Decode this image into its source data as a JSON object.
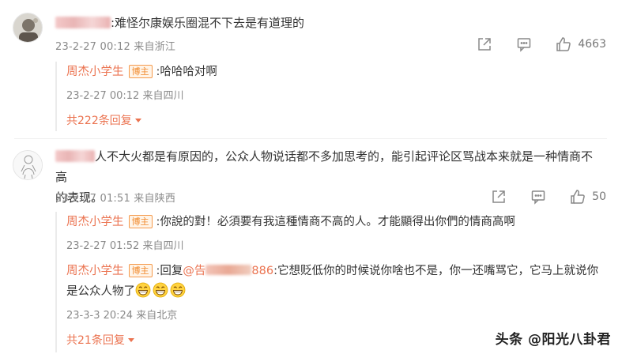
{
  "comments": [
    {
      "text": ":难怪尔康娱乐圈混不下去是有道理的",
      "time": "23-2-27 00:12",
      "location": "来自浙江",
      "like_count": "4663",
      "replies": [
        {
          "username": "周杰小学生",
          "badge": "博主",
          "text": ":哈哈哈对啊",
          "time": "23-2-27 00:12",
          "location": "来自四川"
        }
      ],
      "more_label": "共222条回复"
    },
    {
      "text_line1": "人不大火都是有原因的，公众人物说话都不多加思考的，能引起评论区骂战本来就是一种情商不高",
      "text_line2": "的表现。",
      "time": "23-2-27 01:51",
      "location": "来自陕西",
      "like_count": "50",
      "replies": [
        {
          "username": "周杰小学生",
          "badge": "博主",
          "text": ":你說的對！必須要有我這種情商不高的人。才能顯得出你們的情商高啊",
          "time": "23-2-27 01:52",
          "location": "来自四川"
        },
        {
          "username": "周杰小学生",
          "badge": "博主",
          "text_prefix": ":回复",
          "mention_start": "@告",
          "mention_end": "886",
          "text_line1": ":它想贬低你的时候说你啥也不是，你一还嘴骂它，它马上就说你",
          "text_line2": "是公众人物了",
          "time": "23-3-3 20:24",
          "location": "来自北京"
        }
      ],
      "more_label": "共21条回复"
    }
  ],
  "icons": {
    "share": "share-icon",
    "comment": "comment-icon",
    "like": "like-icon",
    "emoji": "grin-emoji-icon"
  },
  "colors": {
    "username": "#eb7350",
    "badge_border": "#f59a4b",
    "meta": "#8a8a8a"
  },
  "watermark": "头条 @阳光八卦君"
}
